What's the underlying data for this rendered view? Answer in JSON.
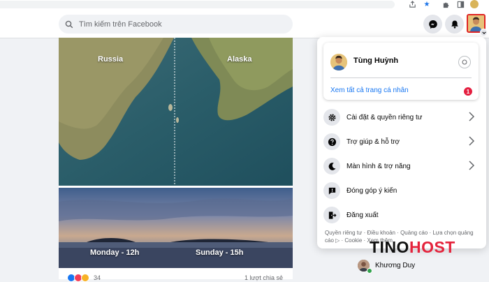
{
  "search": {
    "placeholder": "Tìm kiếm trên Facebook"
  },
  "profile": {
    "name": "Tùng Huỳnh",
    "see_all_label": "Xem tất cả trang cá nhân",
    "badge_count": "1"
  },
  "menu": {
    "items": [
      {
        "label": "Cài đặt & quyền riêng tư",
        "icon": "gear-icon",
        "has_chevron": true
      },
      {
        "label": "Trợ giúp & hỗ trợ",
        "icon": "question-icon",
        "has_chevron": true
      },
      {
        "label": "Màn hình & trợ năng",
        "icon": "moon-icon",
        "has_chevron": true
      },
      {
        "label": "Đóng góp ý kiến",
        "icon": "feedback-icon",
        "has_chevron": false
      },
      {
        "label": "Đăng xuất",
        "icon": "logout-icon",
        "has_chevron": false
      }
    ],
    "footer": "Quyền riêng tư · Điều khoản · Quảng cáo · Lựa chọn quảng cáo ▷ · Cookie · Xem thêm"
  },
  "post": {
    "map_labels": {
      "left": "Russia",
      "right": "Alaska"
    },
    "time_labels": {
      "left": "Monday - 12h",
      "right": "Sunday - 15h"
    },
    "reaction_count": "34",
    "share_count": "1 lượt chia sẻ"
  },
  "contacts": [
    {
      "name": "Khương Duy"
    }
  ],
  "watermark": {
    "part1": "TINO",
    "part2": "HOST"
  },
  "colors": {
    "accent": "#1877f2",
    "badge": "#e41e3f",
    "highlight": "#e02424",
    "background": "#f0f2f5"
  }
}
